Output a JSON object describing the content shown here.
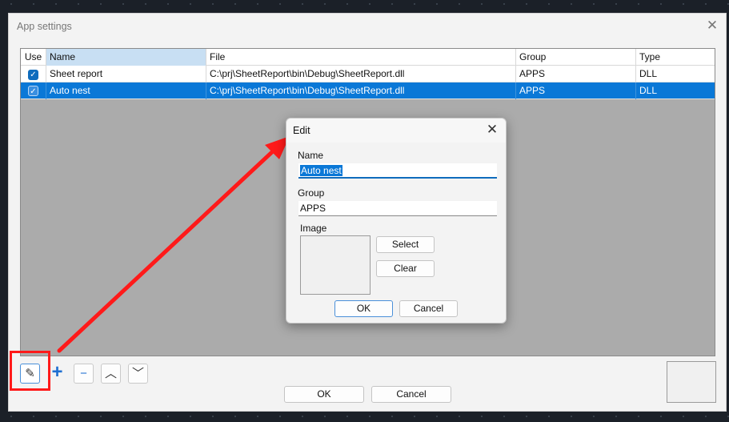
{
  "main_window": {
    "title": "App settings",
    "close_glyph": "✕",
    "grid": {
      "columns": [
        "Use",
        "Name",
        "File",
        "Group",
        "Type"
      ],
      "rows": [
        {
          "use": "✓",
          "name": "Sheet report",
          "file": "C:\\prj\\SheetReport\\bin\\Debug\\SheetReport.dll",
          "group": "APPS",
          "type": "DLL",
          "selected": false
        },
        {
          "use": "✓",
          "name": "Auto nest",
          "file": "C:\\prj\\SheetReport\\bin\\Debug\\SheetReport.dll",
          "group": "APPS",
          "type": "DLL",
          "selected": true
        }
      ]
    },
    "toolbar": {
      "edit_glyph": "✎",
      "add_glyph": "+",
      "remove_glyph": "−",
      "up_glyph": "︿",
      "down_glyph": "﹀"
    },
    "ok_label": "OK",
    "cancel_label": "Cancel"
  },
  "edit_dialog": {
    "title": "Edit",
    "close_glyph": "✕",
    "name_label": "Name",
    "name_value": "Auto nest",
    "group_label": "Group",
    "group_value": "APPS",
    "image_label": "Image",
    "select_label": "Select",
    "clear_label": "Clear",
    "ok_label": "OK",
    "cancel_label": "Cancel"
  },
  "annotation": {
    "arrow_color": "#ff1a1a",
    "highlight_color": "#ff1a1a"
  },
  "colors": {
    "selection": "#0a78d7",
    "accent": "#0f6cbd"
  }
}
